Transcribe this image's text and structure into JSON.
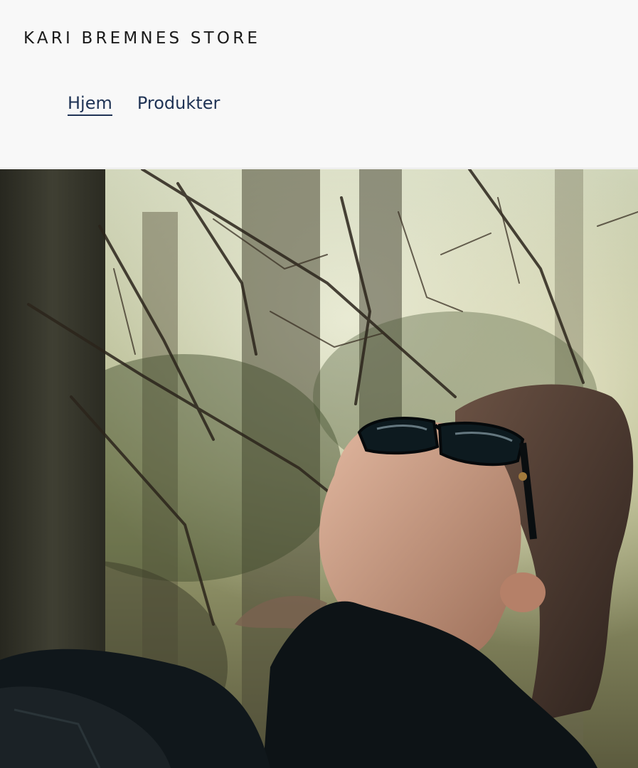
{
  "header": {
    "store_title": "KARI BREMNES STORE",
    "nav": [
      {
        "label": "Hjem",
        "active": true
      },
      {
        "label": "Produkter",
        "active": false
      }
    ]
  },
  "hero": {
    "image": "photo-of-woman-with-sunglasses-looking-up-in-forest"
  },
  "colors": {
    "background": "#f8f8f8",
    "title": "#1a1a1a",
    "nav_link": "#1f3355"
  }
}
